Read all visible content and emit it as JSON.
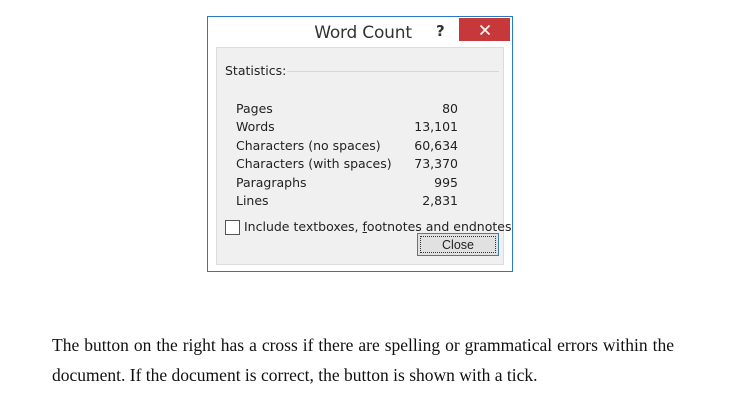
{
  "dialog": {
    "title": "Word Count",
    "help_label": "?",
    "close_icon": "close-icon",
    "close_color": "#c7383a",
    "border_color": "#2b79c4",
    "statistics_label": "Statistics:",
    "stats": [
      {
        "label": "Pages",
        "value": "80"
      },
      {
        "label": "Words",
        "value": "13,101"
      },
      {
        "label": "Characters (no spaces)",
        "value": "60,634"
      },
      {
        "label": "Characters (with spaces)",
        "value": "73,370"
      },
      {
        "label": "Paragraphs",
        "value": "995"
      },
      {
        "label": "Lines",
        "value": "2,831"
      }
    ],
    "checkbox": {
      "label_before": "Include textboxes, ",
      "label_accel": "f",
      "label_after": "ootnotes and endnotes",
      "checked": false
    },
    "close_button_label": "Close"
  },
  "document": {
    "paragraph": "The button on the right has a cross if there are spelling or grammatical errors within the document. If the document is correct, the button is shown with a tick."
  }
}
